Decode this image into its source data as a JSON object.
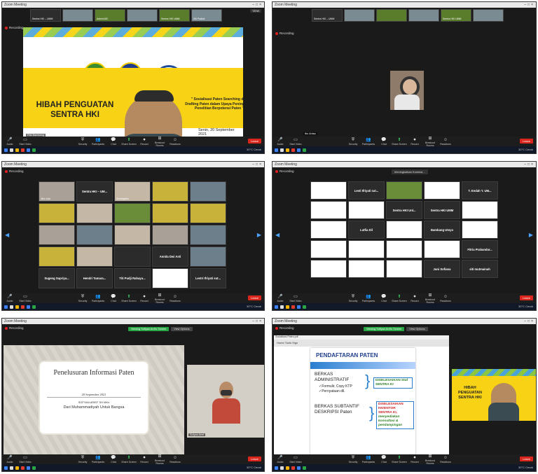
{
  "common": {
    "window_title": "Zoom Meeting",
    "recording": "Recording",
    "view": "View",
    "leave": "Leave",
    "weather": "30°C Cerah",
    "toolbar": [
      "Audio",
      "Start Video",
      "Security",
      "Participants",
      "Chat",
      "Share Screen",
      "Record",
      "Breakout Rooms",
      "Reactions"
    ],
    "toolbar_icons": [
      "mic-icon",
      "video-icon",
      "shield-icon",
      "people-icon",
      "chat-icon",
      "share-icon",
      "record-icon",
      "breakout-icon",
      "smile-icon"
    ]
  },
  "panel1": {
    "thumbs": [
      "Sentra HKI – UMM",
      "",
      "Admin/UB",
      "",
      "Sentra HKI UMM",
      "Siti Pratiwi"
    ],
    "slide_title": "HIBAH PENGUATAN SENTRA HKI",
    "ristek": "RISTEK-BRIN",
    "subtitle": "\" Sosialisasi Paten Searching dan Drafting Paten dalam Upaya Peningkatan Penelitian Berpotensi Paten \"",
    "date": "Senin, 20 September 2021",
    "speaker_tag": "Pak Bambang"
  },
  "panel2": {
    "thumbs": [
      "Sentra HKI – UMM",
      "",
      "",
      "",
      "Sentra HKI UMM",
      ""
    ],
    "speaker_tag": "Ibu Anisa"
  },
  "panel3": {
    "tiles": [
      "Jihin Uda",
      "Sentra HKI – UMM",
      "Sentrapaten",
      "",
      "",
      "",
      "",
      "",
      "",
      "",
      "",
      "",
      "",
      "",
      "",
      "",
      "",
      "",
      "",
      "",
      "Annita Dwi Asti",
      "",
      "Sugeng Supriya...",
      "Hendri Tamara...",
      "Titi Pudji Rahayu...",
      "",
      "Lestri Ifriyati sut..."
    ],
    "labels": [
      "Sentra HKI – UM...",
      "Annita Dwi Asti",
      "Sugeng Supriya...",
      "Hendri Tamara...",
      "Titi Pudji Rahayu...",
      "Lestri Ifriyati sut..."
    ]
  },
  "panel4": {
    "bar": "Meningkatkan Koneksi...",
    "cells": [
      "",
      "Lesti Ifriyati sut...",
      "",
      "",
      "T. Endah Y. UM...",
      "",
      "",
      "Sentra HKI Unl...",
      "Sentra HKI UMM",
      "",
      "",
      "",
      "Lutfia Dil",
      "",
      "Bambang Utoyo",
      "",
      "",
      "",
      "",
      "",
      "Fitria Prabandar...",
      "",
      "",
      "",
      "Juni Sofiana",
      "siti mutmainah"
    ]
  },
  "panel5": {
    "bar": [
      "Viewing Sofiyan Ardi's Screen",
      "View Options"
    ],
    "title": "Penelusuran Informasi Paten",
    "date": "20 September 2021",
    "author": "SOFYAN ARIEF SH MKn",
    "sub": "Dari Muhammadiyah Untuk Bangsa",
    "cam_tag": "Sofyan Arief"
  },
  "panel6": {
    "bar": [
      "Viewing Sofiyan Ardi's Screen",
      "View Options"
    ],
    "pdf_title": "Sosialisasi Paten.pdf",
    "tools": "Home  Tools  Sign",
    "head": "PENDAFTARAN PATEN",
    "item1": "BERKAS ADMINISTRATIF",
    "item1a": "✓Formulir, Copy KTP",
    "item1b": "✓Pernyataan dll.",
    "box1": "DISELESAIKAN Staf SENTRA KI",
    "item2": "BERKAS SUBTANTIF DESKRIPSI Paten",
    "box2a": "DISELESAIKAN INVENTOR",
    "box2b": "SENTRA KI,",
    "box2c": "menyediakan konsultasi & pendampingan",
    "mini_title": "HIBAH PENGUATAN SENTRA HKI"
  }
}
